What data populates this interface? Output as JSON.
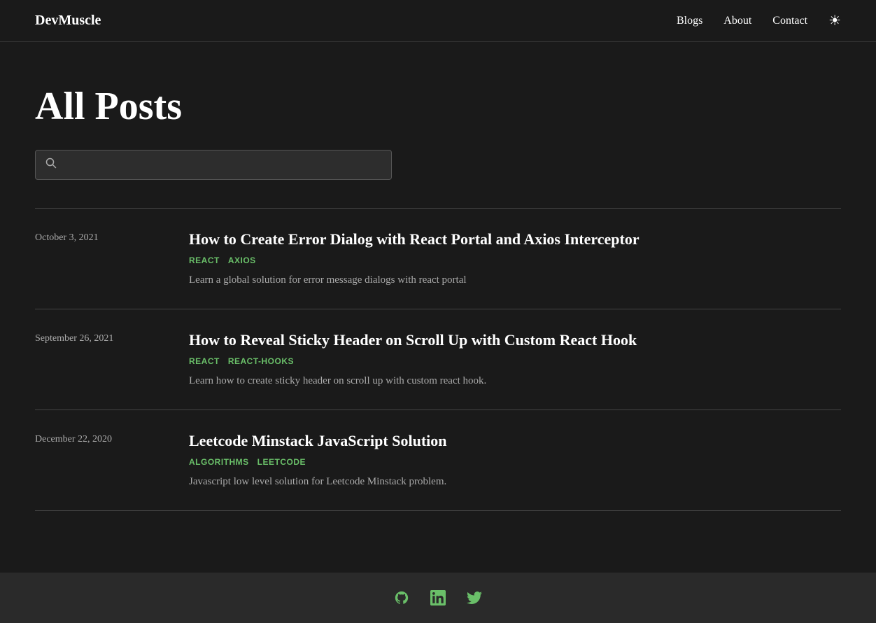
{
  "site": {
    "logo": "DevMuscle"
  },
  "nav": {
    "links": [
      {
        "label": "Blogs",
        "href": "#"
      },
      {
        "label": "About",
        "href": "#"
      },
      {
        "label": "Contact",
        "href": "#"
      }
    ],
    "theme_toggle_label": "☀"
  },
  "main": {
    "page_title": "All Posts",
    "search": {
      "placeholder": ""
    },
    "posts": [
      {
        "date": "October 3, 2021",
        "title": "How to Create Error Dialog with React Portal and Axios Interceptor",
        "tags": [
          "REACT",
          "AXIOS"
        ],
        "description": "Learn a global solution for error message dialogs with react portal"
      },
      {
        "date": "September 26, 2021",
        "title": "How to Reveal Sticky Header on Scroll Up with Custom React Hook",
        "tags": [
          "REACT",
          "REACT-HOOKS"
        ],
        "description": "Learn how to create sticky header on scroll up with custom react hook."
      },
      {
        "date": "December 22, 2020",
        "title": "Leetcode Minstack JavaScript Solution",
        "tags": [
          "ALGORITHMS",
          "LEETCODE"
        ],
        "description": "Javascript low level solution for Leetcode Minstack problem."
      }
    ]
  },
  "footer": {
    "icons": [
      {
        "name": "github-icon",
        "label": "GitHub"
      },
      {
        "name": "linkedin-icon",
        "label": "LinkedIn"
      },
      {
        "name": "twitter-icon",
        "label": "Twitter"
      }
    ]
  }
}
